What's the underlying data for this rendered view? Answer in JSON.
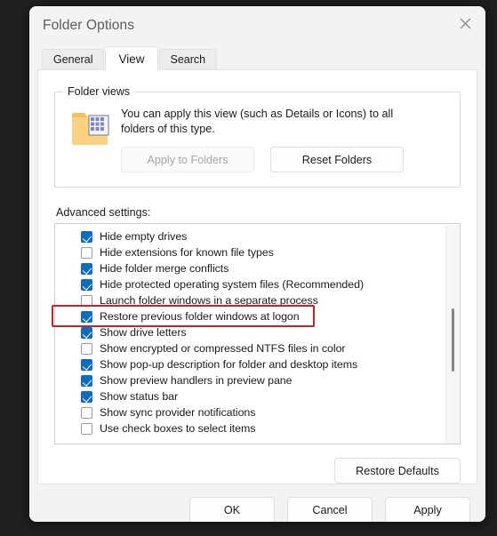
{
  "window": {
    "title": "Folder Options",
    "close_icon": "close-icon"
  },
  "tabs": [
    {
      "label": "General",
      "active": false
    },
    {
      "label": "View",
      "active": true
    },
    {
      "label": "Search",
      "active": false
    }
  ],
  "folder_views": {
    "legend": "Folder views",
    "icon": "folder-view-icon",
    "description": "You can apply this view (such as Details or Icons) to all folders of this type.",
    "apply_button": {
      "label": "Apply to Folders",
      "disabled": true
    },
    "reset_button": {
      "label": "Reset Folders",
      "disabled": false
    }
  },
  "advanced_settings": {
    "label": "Advanced settings:",
    "items": [
      {
        "label": "Hide empty drives",
        "checked": true,
        "highlighted": false
      },
      {
        "label": "Hide extensions for known file types",
        "checked": false,
        "highlighted": false
      },
      {
        "label": "Hide folder merge conflicts",
        "checked": true,
        "highlighted": false
      },
      {
        "label": "Hide protected operating system files (Recommended)",
        "checked": true,
        "highlighted": false
      },
      {
        "label": "Launch folder windows in a separate process",
        "checked": false,
        "highlighted": false
      },
      {
        "label": "Restore previous folder windows at logon",
        "checked": true,
        "highlighted": true
      },
      {
        "label": "Show drive letters",
        "checked": true,
        "highlighted": false
      },
      {
        "label": "Show encrypted or compressed NTFS files in color",
        "checked": false,
        "highlighted": false
      },
      {
        "label": "Show pop-up description for folder and desktop items",
        "checked": true,
        "highlighted": false
      },
      {
        "label": "Show preview handlers in preview pane",
        "checked": true,
        "highlighted": false
      },
      {
        "label": "Show status bar",
        "checked": true,
        "highlighted": false
      },
      {
        "label": "Show sync provider notifications",
        "checked": false,
        "highlighted": false
      },
      {
        "label": "Use check boxes to select items",
        "checked": false,
        "highlighted": false
      }
    ],
    "scrollbar": {
      "thumb_top_pct": 38,
      "thumb_height_pct": 29
    }
  },
  "restore_defaults_button": {
    "label": "Restore Defaults"
  },
  "footer_buttons": [
    {
      "label": "OK"
    },
    {
      "label": "Cancel"
    },
    {
      "label": "Apply"
    }
  ],
  "colors": {
    "accent": "#0f6cbd",
    "annotation": "#cc2127",
    "desktop": "#1f1f1f",
    "dialog": "#f3f3f3"
  }
}
